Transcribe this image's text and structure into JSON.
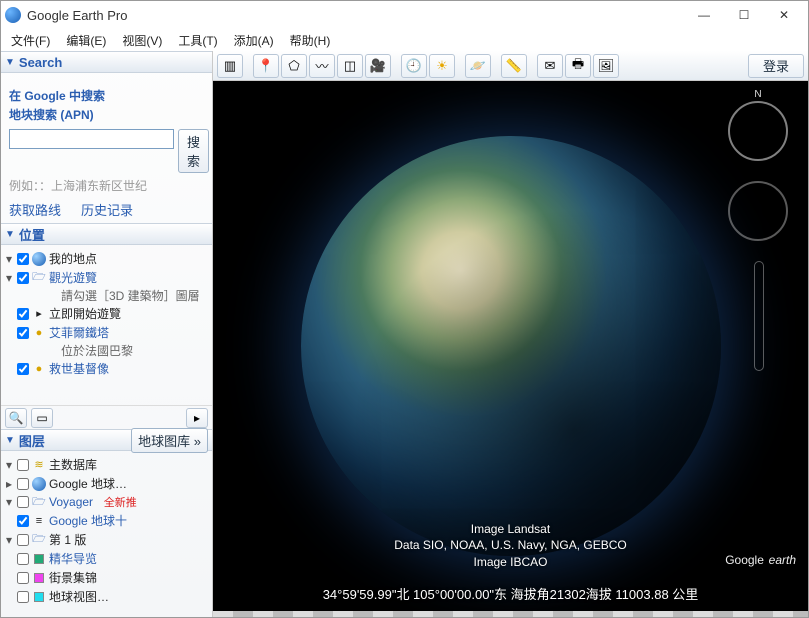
{
  "window": {
    "title": "Google Earth Pro"
  },
  "menubar": {
    "file": "文件(F)",
    "edit": "编辑(E)",
    "view": "视图(V)",
    "tools": "工具(T)",
    "add": "添加(A)",
    "help": "帮助(H)"
  },
  "toolbar": {
    "login": "登录"
  },
  "search": {
    "title": "Search",
    "opt_google": "在 Google 中搜索",
    "opt_apn": "地块搜索 (APN)",
    "btn": "搜索",
    "example": "例如：：上海浦东新区世纪",
    "link_route": "获取路线",
    "link_history": "历史记录"
  },
  "places": {
    "title": "位置",
    "my_places": "我的地点",
    "sightseeing": "觀光遊覽",
    "sightseeing_hint": "請勾選［3D 建築物］圖層",
    "start_tour": "立即開始遊覽",
    "eiffel": "艾菲爾鐵塔",
    "eiffel_desc": "位於法國巴黎",
    "christ": "救世基督像"
  },
  "layers": {
    "title": "图层",
    "gallery_btn": "地球图库 »",
    "primary_db": "主数据库",
    "google_earth": "Google 地球…",
    "voyager": "Voyager",
    "voyager_new": "全新推",
    "google_more": "Google   地球十",
    "edition1": "第 1 版",
    "highlights": "精华导览",
    "streetview": "街景集锦",
    "globeview": "地球视图…"
  },
  "credits": {
    "l1": "Image Landsat",
    "l2": "Data SIO, NOAA, U.S. Navy, NGA, GEBCO",
    "l3": "Image IBCAO"
  },
  "brand": {
    "g": "Google",
    "e": "earth"
  },
  "status": {
    "text": "34°59'59.99\"北 105°00'00.00\"东 海拔角21302海拔  11003.88 公里"
  }
}
